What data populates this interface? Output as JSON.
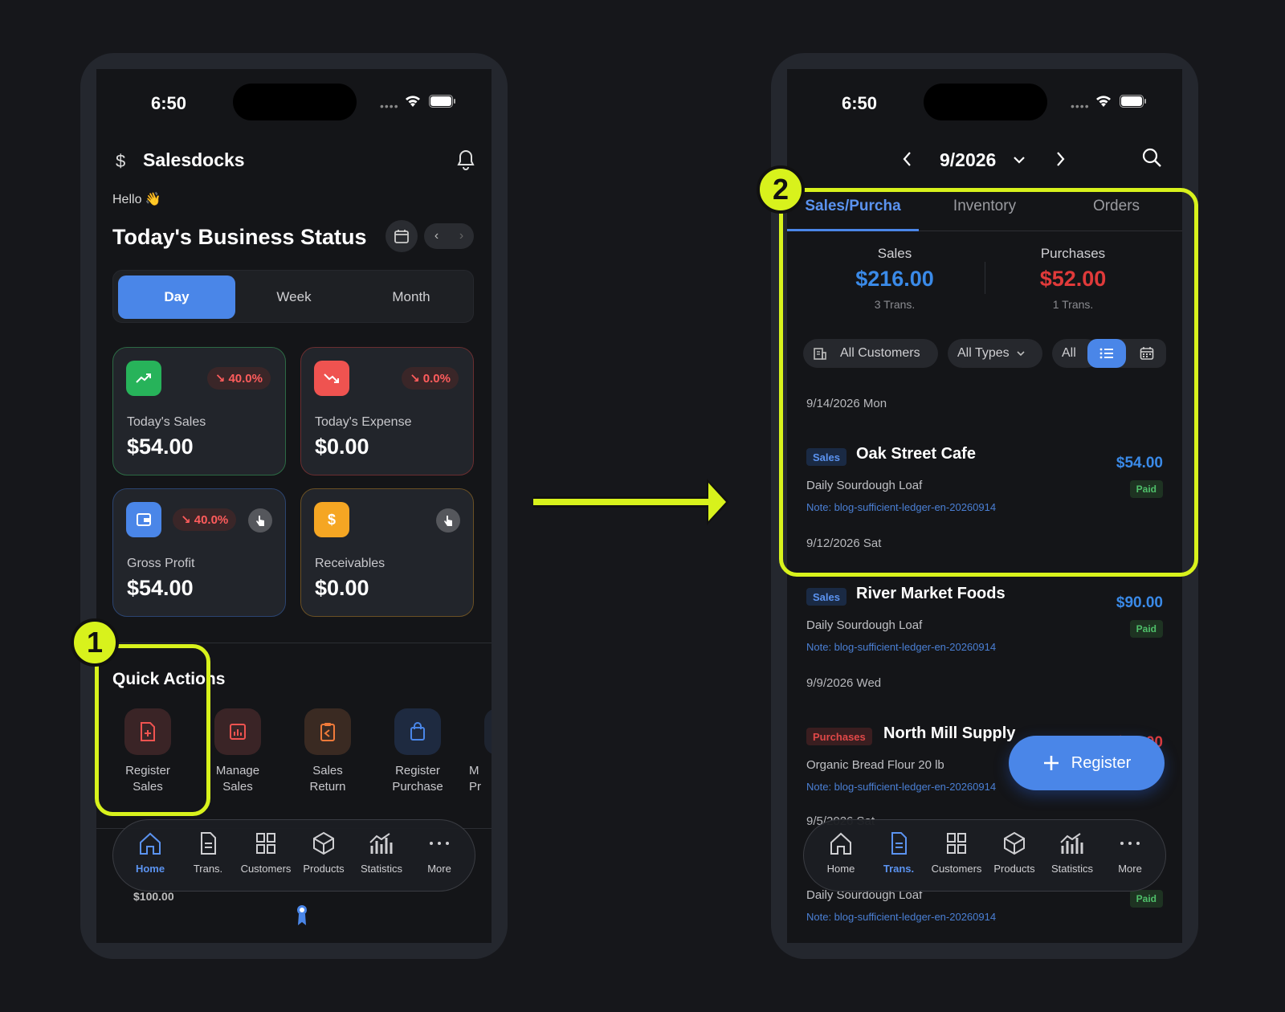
{
  "status_bar": {
    "time": "6:50"
  },
  "home": {
    "brand": "Salesdocks",
    "greeting": "Hello 👋",
    "title": "Today's Business Status",
    "periods": [
      "Day",
      "Week",
      "Month"
    ],
    "active_period": "Day",
    "cards": [
      {
        "label": "Today's Sales",
        "value": "$54.00",
        "badge": "↘ 40.0%",
        "accent": "#27b35a"
      },
      {
        "label": "Today's Expense",
        "value": "$0.00",
        "badge": "↘ 0.0%",
        "accent": "#ef5350"
      },
      {
        "label": "Gross Profit",
        "value": "$54.00",
        "badge": "↘ 40.0%",
        "accent": "#4a86e8"
      },
      {
        "label": "Receivables",
        "value": "$0.00",
        "badge": "",
        "accent": "#f5a623"
      }
    ],
    "receivable_icon": "$",
    "quick_actions_title": "Quick Actions",
    "quick_actions": [
      {
        "line1": "Register",
        "line2": "Sales"
      },
      {
        "line1": "Manage",
        "line2": "Sales"
      },
      {
        "line1": "Sales",
        "line2": "Return"
      },
      {
        "line1": "Register",
        "line2": "Purchase"
      },
      {
        "line1": "M",
        "line2": "Pr"
      }
    ],
    "chart_peek": "$100.00"
  },
  "nav": {
    "items": [
      "Home",
      "Trans.",
      "Customers",
      "Products",
      "Statistics",
      "More"
    ]
  },
  "transactions": {
    "month": "9/2026",
    "tabs": [
      "Sales/Purcha",
      "Inventory",
      "Orders"
    ],
    "summary": {
      "sales_label": "Sales",
      "sales_value": "$216.00",
      "sales_trans": "3 Trans.",
      "purchases_label": "Purchases",
      "purchases_value": "$52.00",
      "purchases_trans": "1 Trans."
    },
    "filters": {
      "customers": "All Customers",
      "types": "All Types",
      "all": "All"
    },
    "groups": [
      {
        "date": "9/14/2026 Mon"
      },
      {
        "date": "9/12/2026 Sat"
      },
      {
        "date": "9/9/2026 Wed"
      },
      {
        "date": "9/5/2026 Sat"
      }
    ],
    "items": [
      {
        "type": "Sales",
        "name": "Oak Street Cafe",
        "item": "Daily Sourdough Loaf",
        "note": "Note: blog-sufficient-ledger-en-20260914",
        "amount": "$54.00",
        "status": "Paid"
      },
      {
        "type": "Sales",
        "name": "River Market Foods",
        "item": "Daily Sourdough Loaf",
        "note": "Note: blog-sufficient-ledger-en-20260914",
        "amount": "$90.00",
        "status": "Paid"
      },
      {
        "type": "Purchases",
        "name": "North Mill Supply",
        "item": "Organic Bread Flour 20 lb",
        "note": "Note: blog-sufficient-ledger-en-20260914",
        "amount": "$52.00",
        "status": ""
      },
      {
        "type": "",
        "name": "",
        "item": "Daily Sourdough Loaf",
        "note": "Note: blog-sufficient-ledger-en-20260914",
        "amount": "",
        "status": "Paid"
      }
    ],
    "fab_label": "Register"
  },
  "annotations": {
    "step1": "1",
    "step2": "2"
  },
  "colors": {
    "accent": "#4a86e8",
    "highlight": "#d8f21c",
    "sales": "#3a8ae8",
    "purchases": "#e03a3a"
  }
}
